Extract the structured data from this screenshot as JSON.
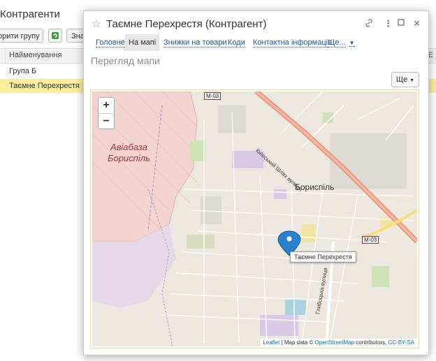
{
  "background": {
    "title": "Контрагенти",
    "toolbar": {
      "create_group_label": "орити групу",
      "third_button_label": "Зна"
    },
    "table": {
      "column_name": "Найменування",
      "column_extra": "Е",
      "rows": [
        {
          "name": "Група Б",
          "selected": false
        },
        {
          "name": "Таємне Перехрестя",
          "selected": true
        }
      ]
    }
  },
  "modal": {
    "title": "Таємне Перехрестя (Контрагент)",
    "tabs": [
      {
        "label": "Головне",
        "active": false
      },
      {
        "label": "На мапі",
        "active": true
      },
      {
        "label": "Знижки на товари",
        "active": false
      },
      {
        "label": "Коди",
        "active": false
      },
      {
        "label": "Контактна інформація",
        "active": false
      },
      {
        "label": "Ще...",
        "active": false
      }
    ],
    "section_title": "Перегляд мапи",
    "more_button": "Ще",
    "map": {
      "zoom_in": "+",
      "zoom_out": "−",
      "area_label": "Авіабаза\nБориспіль",
      "city_label": "Бориспіль",
      "road_label_1": "Київський Шлях вулиця",
      "road_label_2": "Глибоцька вулиця",
      "highway_shield_1": "М-03",
      "highway_shield_2": "М-03",
      "marker_tooltip": "Таємне Перехрестя",
      "attribution": {
        "leaflet": "Leaflet",
        "sep": " | Map data © ",
        "osm": "OpenStreetMap",
        "contrib": " contributors, ",
        "license": "CC-BY-SA"
      }
    }
  },
  "colors": {
    "selected_row": "#fbed9e",
    "link": "#1a56a9",
    "map_road_major": "#e8917a",
    "map_airbase": "#f3d3d0",
    "marker": "#2a81cb"
  }
}
